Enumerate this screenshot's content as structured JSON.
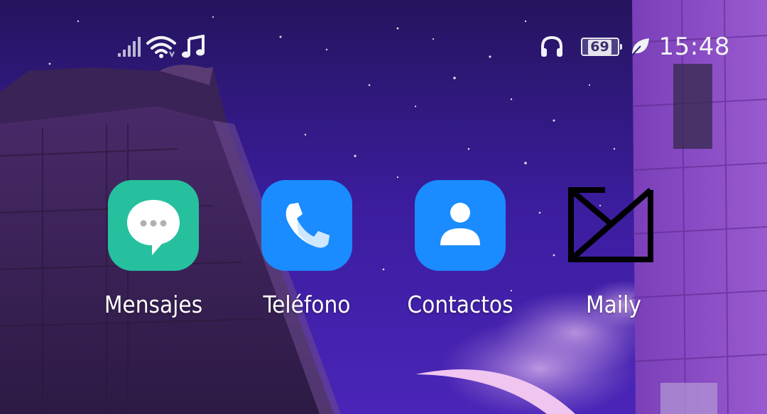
{
  "status_bar": {
    "left_icons": [
      "signal-icon",
      "wifi-icon",
      "music-note-icon"
    ],
    "right_icons": [
      "headphones-icon",
      "battery-icon",
      "leaf-icon"
    ],
    "battery_level": "69",
    "time": "15:48"
  },
  "apps": [
    {
      "label": "Mensajes",
      "icon": "messages-icon",
      "color": "#26c09f"
    },
    {
      "label": "Teléfono",
      "icon": "phone-icon",
      "color": "#1a8cff"
    },
    {
      "label": "Contactos",
      "icon": "contacts-icon",
      "color": "#1a8cff"
    },
    {
      "label": "Maily",
      "icon": "maily-icon",
      "color": "#000000"
    }
  ]
}
